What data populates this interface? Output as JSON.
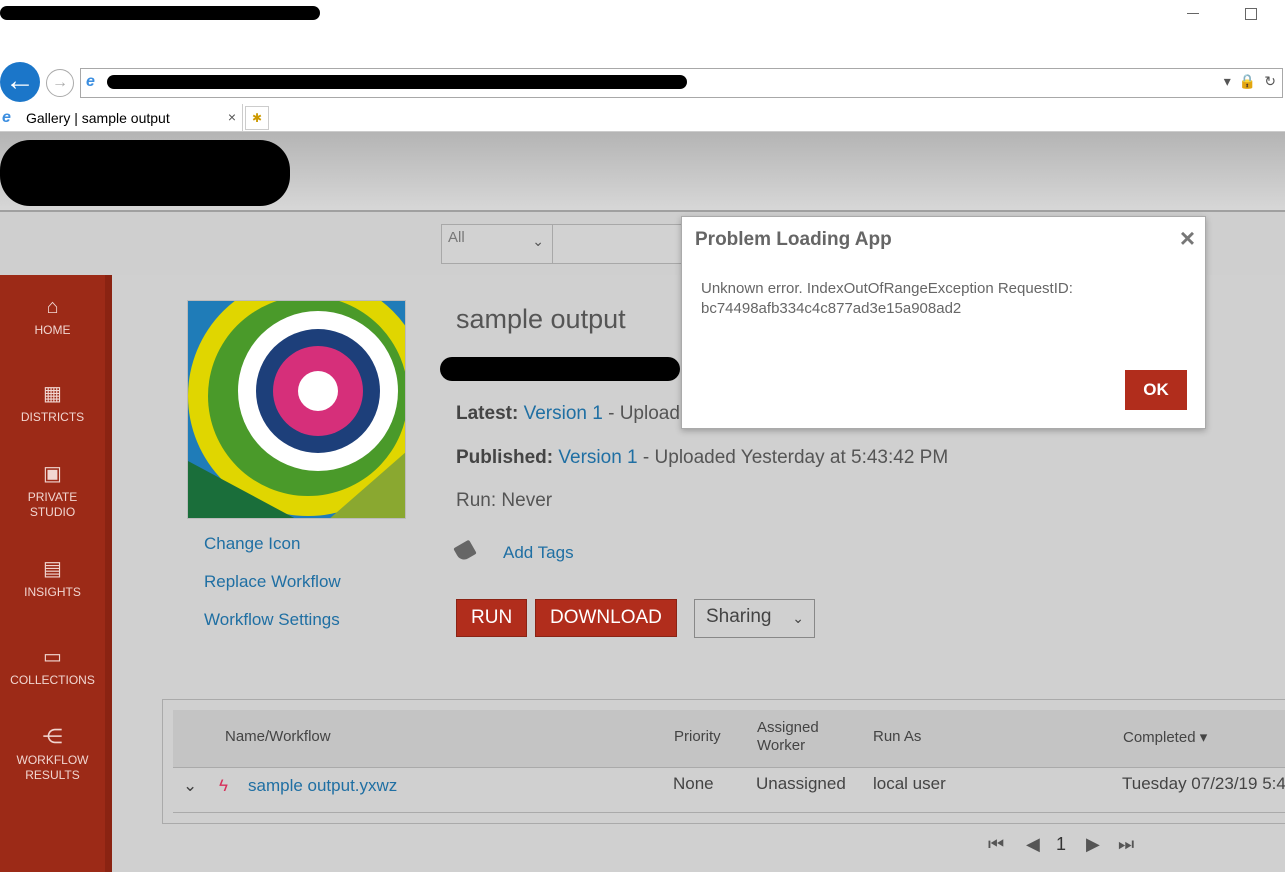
{
  "browser": {
    "tab_title": "Gallery | sample output",
    "tab_close": "×",
    "back_glyph": "←",
    "fwd_glyph": "→",
    "ie_glyph": "e",
    "addr_dropdown": "▾",
    "addr_lock": "🔒",
    "addr_refresh": "↻",
    "newtab_glyph": "✱"
  },
  "search": {
    "scope_selected": "All",
    "scope_chevron": "⌄"
  },
  "sidebar": {
    "items": [
      {
        "label": "HOME",
        "icon": "home-icon",
        "glyph": "⌂"
      },
      {
        "label": "DISTRICTS",
        "icon": "districts-icon",
        "glyph": "▦"
      },
      {
        "label": "PRIVATE STUDIO",
        "icon": "private-studio-icon",
        "glyph": "▣"
      },
      {
        "label": "INSIGHTS",
        "icon": "insights-icon",
        "glyph": "▤"
      },
      {
        "label": "COLLECTIONS",
        "icon": "briefcase-icon",
        "glyph": "▭"
      },
      {
        "label": "WORKFLOW RESULTS",
        "icon": "workflow-icon",
        "glyph": "⋲"
      }
    ]
  },
  "app": {
    "title": "sample output",
    "latest_label": "Latest:",
    "latest_version": "Version 1",
    "latest_rest": "- Upload",
    "published_label": "Published:",
    "published_version": "Version 1",
    "published_rest": "- Uploaded Yesterday at 5:43:42 PM",
    "run_text": "Run: Never",
    "add_tags": "Add Tags",
    "links": {
      "change_icon": "Change Icon",
      "replace_workflow": "Replace Workflow",
      "workflow_settings": "Workflow Settings"
    },
    "buttons": {
      "run": "RUN",
      "download": "DOWNLOAD",
      "sharing": "Sharing",
      "sharing_chevron": "⌄"
    }
  },
  "table": {
    "headers": {
      "name": "Name/Workflow",
      "priority": "Priority",
      "assigned_worker_line1": "Assigned",
      "assigned_worker_line2": "Worker",
      "run_as": "Run As",
      "completed": "Completed ▾"
    },
    "rows": [
      {
        "expand": "⌄",
        "status_glyph": "ϟ",
        "name": "sample output.yxwz",
        "priority": "None",
        "assigned_worker": "Unassigned",
        "run_as": "local user",
        "completed": "Tuesday 07/23/19 5:4"
      }
    ]
  },
  "pager": {
    "first": "⏮",
    "prev": "◀",
    "page": "1",
    "next": "▶",
    "last": "⏭"
  },
  "modal": {
    "title": "Problem Loading App",
    "close": "×",
    "body": "Unknown error. IndexOutOfRangeException RequestID: bc74498afb334c4c877ad3e15a908ad2",
    "ok": "OK"
  },
  "colors": {
    "sidebar": "#9c2a17",
    "accent_red": "#b12d1c",
    "link": "#1f6fa3",
    "browser_back": "#1b76c9"
  }
}
